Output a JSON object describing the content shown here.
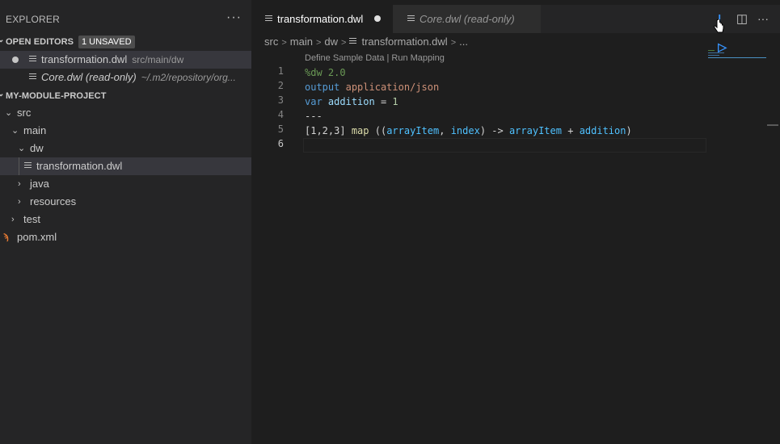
{
  "explorer": {
    "title": "EXPLORER",
    "more_icon": "ellipsis-icon",
    "open_editors": {
      "label": "OPEN EDITORS",
      "badge": "1 UNSAVED",
      "items": [
        {
          "name": "transformation.dwl",
          "desc": "src/main/dw",
          "modified": true
        },
        {
          "name": "Core.dwl (read-only)",
          "desc": "~/.m2/repository/org..."
        }
      ]
    },
    "project": {
      "label": "MY-MODULE-PROJECT",
      "tree": {
        "src": "src",
        "main": "main",
        "dw": "dw",
        "transformation": "transformation.dwl",
        "java": "java",
        "resources": "resources",
        "test": "test",
        "pom": "pom.xml"
      }
    }
  },
  "tabs": [
    {
      "label": "transformation.dwl",
      "active": true,
      "modified": true
    },
    {
      "label": "Core.dwl (read-only)",
      "active": false
    }
  ],
  "toolbar": {
    "run_icon": "run-preview-icon",
    "split_icon": "split-editor-icon",
    "more_icon": "ellipsis-icon"
  },
  "breadcrumb": [
    "src",
    "main",
    "dw",
    "transformation.dwl",
    "..."
  ],
  "codelens": "Define Sample Data | Run Mapping",
  "code": {
    "line_numbers": [
      "1",
      "2",
      "3",
      "4",
      "5",
      "6"
    ],
    "l1": "%dw 2.0",
    "l2_kw": "output",
    "l2_mime": "application/json",
    "l3_kw": "var",
    "l3_name": "addition",
    "l3_eq": "=",
    "l3_val": "1",
    "l4": "---",
    "l5_arr": "[1,2,3]",
    "l5_map": "map",
    "l5_open": "((",
    "l5_p1": "arrayItem",
    "l5_comma": ",",
    "l5_p2": "index",
    "l5_arrow": ") ->",
    "l5_item": "arrayItem",
    "l5_plus": "+",
    "l5_add": "addition",
    "l5_close": ")"
  },
  "colors": {
    "accent_run": "#3794ff",
    "rss": "#e37933"
  }
}
